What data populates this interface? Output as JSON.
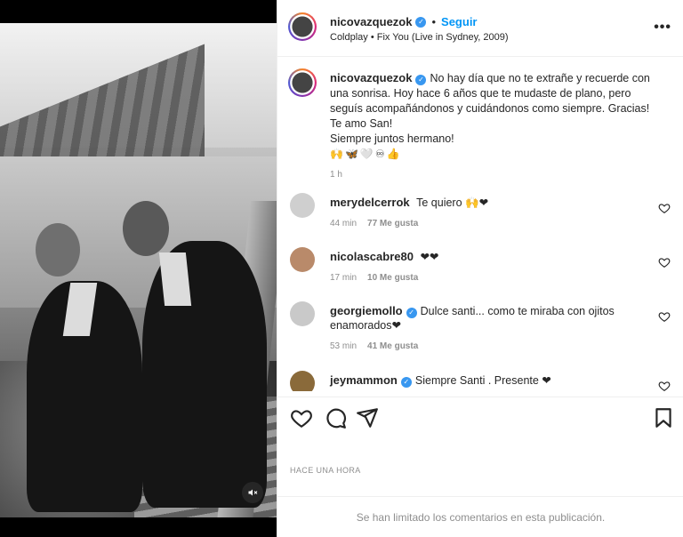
{
  "post": {
    "author": "nicovazquezok",
    "follow_label": "Seguir",
    "separator": "•",
    "song": "Coldplay • Fix You (Live in Sydney, 2009)",
    "more_label": "•••"
  },
  "caption": {
    "author": "nicovazquezok",
    "text": "No hay día que no te extrañe y recuerde con una sonrisa. Hoy hace 6 años que te mudaste de plano, pero seguís acompañándonos y cuidándonos como siempre. Gracias! Te amo San!\nSiempre juntos hermano!",
    "emojis": "🙌🦋🤍♾👍",
    "time": "1 h"
  },
  "comments": [
    {
      "user": "merydelcerrok",
      "verified": false,
      "text": "Te quiero 🙌❤",
      "time": "44 min",
      "likes": "77 Me gusta",
      "avatar_color": "#cfcfcf"
    },
    {
      "user": "nicolascabre80",
      "verified": false,
      "text": "❤❤",
      "time": "17 min",
      "likes": "10 Me gusta",
      "avatar_color": "#b98a6a"
    },
    {
      "user": "georgiemollo",
      "verified": true,
      "text": "Dulce santi... como te miraba con ojitos enamorados❤",
      "time": "53 min",
      "likes": "41 Me gusta",
      "avatar_color": "#c9c9c9"
    },
    {
      "user": "jeymammon",
      "verified": true,
      "text": "Siempre Santi . Presente ❤",
      "time": "",
      "likes": "",
      "avatar_color": "#8a6a3a"
    }
  ],
  "timestamp": "HACE UNA HORA",
  "limited_notice": "Se han limitado los comentarios en esta publicación.",
  "colors": {
    "accent": "#0095f6",
    "verified": "#3897f0",
    "heart": "#ed4956"
  }
}
